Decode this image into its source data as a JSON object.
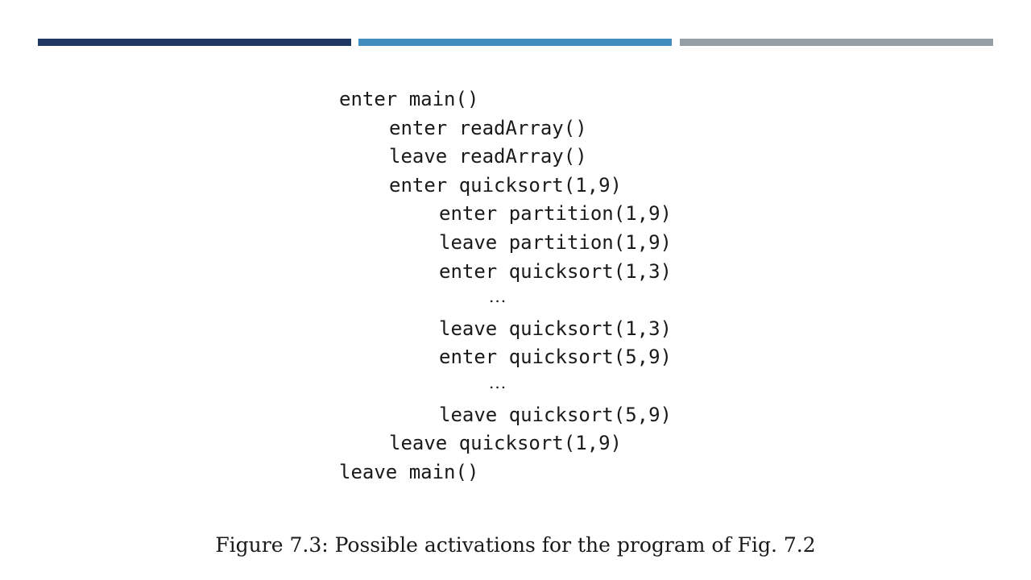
{
  "header_bars": [
    {
      "color": "#1d3863"
    },
    {
      "color": "#418dbd"
    },
    {
      "color": "#969ea5"
    }
  ],
  "trace_lines": [
    {
      "depth": 0,
      "text": "enter main()"
    },
    {
      "depth": 1,
      "text": "enter readArray()"
    },
    {
      "depth": 1,
      "text": "leave readArray()"
    },
    {
      "depth": 1,
      "text": "enter quicksort(1,9)"
    },
    {
      "depth": 2,
      "text": "enter partition(1,9)"
    },
    {
      "depth": 2,
      "text": "leave partition(1,9)"
    },
    {
      "depth": 2,
      "text": "enter quicksort(1,3)"
    },
    {
      "depth": 3,
      "text": "...",
      "ellipsis": true
    },
    {
      "depth": 2,
      "text": "leave quicksort(1,3)"
    },
    {
      "depth": 2,
      "text": "enter quicksort(5,9)"
    },
    {
      "depth": 3,
      "text": "...",
      "ellipsis": true
    },
    {
      "depth": 2,
      "text": "leave quicksort(5,9)"
    },
    {
      "depth": 1,
      "text": "leave quicksort(1,9)"
    },
    {
      "depth": 0,
      "text": "leave main()"
    }
  ],
  "caption": "Figure 7.3: Possible activations for the program of Fig. 7.2"
}
